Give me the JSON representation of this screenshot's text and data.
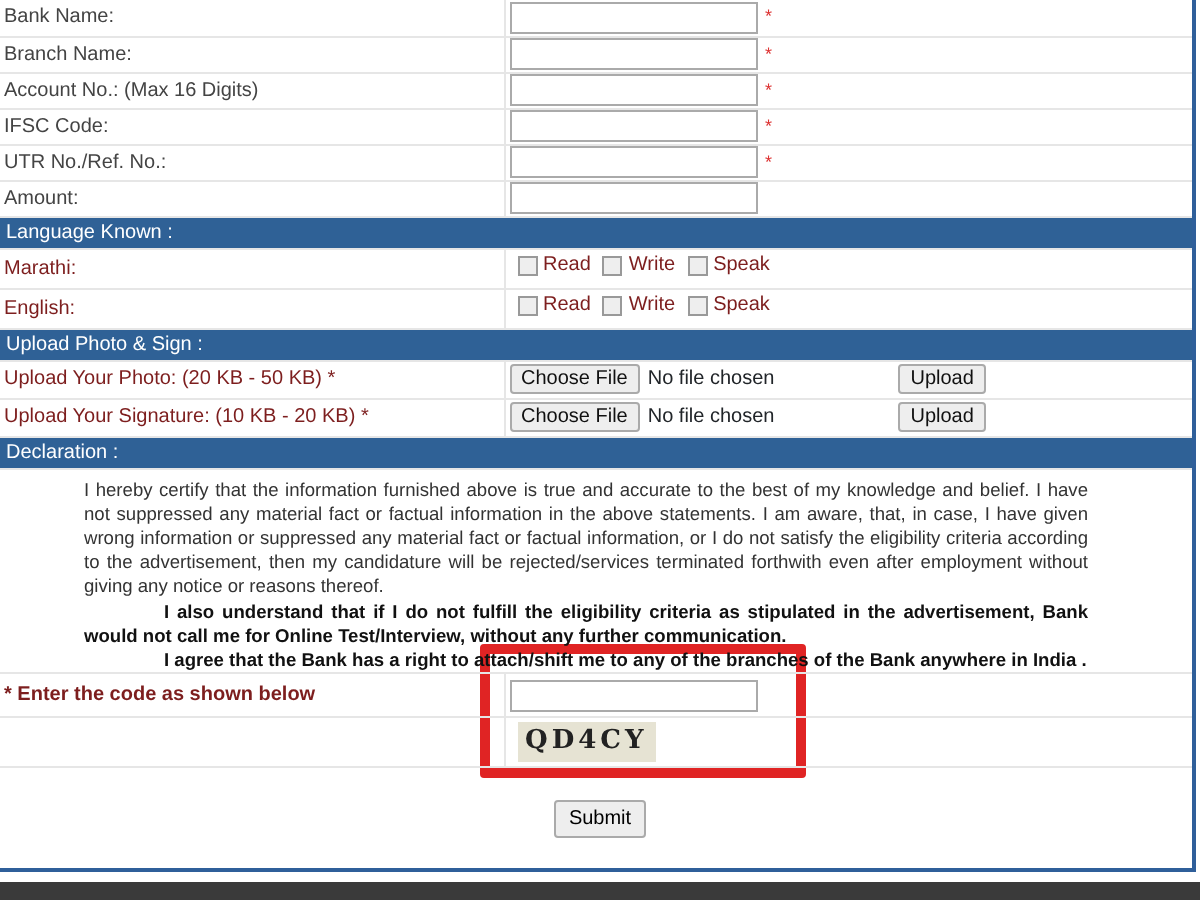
{
  "fields": [
    {
      "label": "Bank Name:",
      "required_mark": "*"
    },
    {
      "label": "Branch Name:",
      "required_mark": "*"
    },
    {
      "label": "Account No.: (Max 16 Digits)",
      "required_mark": "*"
    },
    {
      "label": "IFSC Code:",
      "required_mark": "*"
    },
    {
      "label": "UTR No./Ref. No.:",
      "required_mark": "*"
    },
    {
      "label": "Amount:"
    }
  ],
  "language_section": {
    "title": "Language Known :",
    "languages": [
      {
        "name": "Marathi:",
        "options": [
          {
            "label": "Read",
            "checked": false
          },
          {
            "label": "Write",
            "checked": false
          },
          {
            "label": "Speak",
            "checked": false
          }
        ]
      },
      {
        "name": "English:",
        "options": [
          {
            "label": "Read",
            "checked": false
          },
          {
            "label": "Write",
            "checked": false
          },
          {
            "label": "Speak",
            "checked": false
          }
        ]
      }
    ]
  },
  "upload_section": {
    "title": "Upload Photo & Sign :",
    "uploads": [
      {
        "label": "Upload Your Photo: (20 KB - 50 KB) *",
        "choose_button": "Choose File",
        "status": "No file chosen",
        "upload_button": "Upload"
      },
      {
        "label": "Upload Your Signature: (10 KB - 20 KB)  *",
        "choose_button": "Choose File",
        "status": "No file chosen",
        "upload_button": "Upload"
      }
    ]
  },
  "declaration_section": {
    "title": "Declaration :",
    "paragraphs": [
      {
        "kind": "plain",
        "text": "I hereby certify that the information furnished above is true and accurate to the best of my knowledge and belief.  I have not suppressed any material fact or factual information in the above statements.  I am aware, that, in case, I have given wrong information or suppressed any material fact or factual information, or I do not satisfy the eligibility criteria according to the advertisement, then my candidature will be rejected/services terminated forthwith even after employment without giving any notice or reasons thereof."
      },
      {
        "kind": "bold",
        "text": "I also understand that if I do not fulfill the eligibility criteria as stipulated in the advertisement, Bank would not call me for Online Test/Interview, without any further communication."
      },
      {
        "kind": "bold",
        "text": "I agree that the Bank has a right to attach/shift me to any of the branches of the Bank anywhere in India ."
      }
    ]
  },
  "captcha": {
    "label": "* Enter the code as shown below",
    "code": "QD4CY"
  },
  "submit": "Submit"
}
